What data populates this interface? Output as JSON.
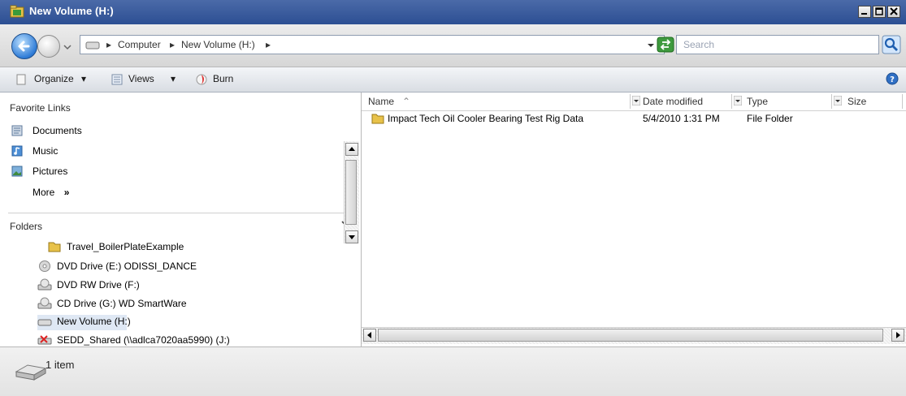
{
  "window": {
    "title": "New Volume (H:)"
  },
  "address_bar": {
    "crumbs": [
      "Computer",
      "New Volume (H:)"
    ],
    "search_placeholder": "Search"
  },
  "toolbar": {
    "organize_label": "Organize",
    "views_label": "Views",
    "burn_label": "Burn"
  },
  "nav_pane": {
    "favorites_title": "Favorite Links",
    "favorites": [
      {
        "label": "Documents",
        "icon": "documents-icon"
      },
      {
        "label": "Music",
        "icon": "music-icon"
      },
      {
        "label": "Pictures",
        "icon": "pictures-icon"
      }
    ],
    "more_label": "More",
    "more_chevron": "»",
    "folders_title": "Folders",
    "tree": [
      {
        "label": "Travel_BoilerPlateExample",
        "icon": "folder-icon"
      },
      {
        "label": "DVD Drive (E:) ODISSI_DANCE",
        "icon": "dvd-drive-icon"
      },
      {
        "label": "DVD RW Drive (F:)",
        "icon": "dvd-rw-drive-icon"
      },
      {
        "label": "CD Drive (G:) WD SmartWare",
        "icon": "cd-drive-icon"
      },
      {
        "label": "New Volume (H:)",
        "icon": "hard-drive-icon",
        "selected": true
      },
      {
        "label": "SEDD_Shared (\\\\adlca7020aa5990) (J:)",
        "icon": "network-drive-disconnected-icon"
      }
    ]
  },
  "file_list": {
    "columns": [
      "Name",
      "Date modified",
      "Type",
      "Size"
    ],
    "sort_indicator": "^",
    "rows": [
      {
        "name": "Impact Tech Oil Cooler Bearing Test Rig Data",
        "date_modified": "5/4/2010 1:31 PM",
        "type": "File Folder",
        "size": ""
      }
    ]
  },
  "status_bar": {
    "item_count": "1 item"
  },
  "colors": {
    "titlebar": "#2c4f93",
    "selection": "#dfe8f4",
    "folder": "#e8c24a"
  }
}
